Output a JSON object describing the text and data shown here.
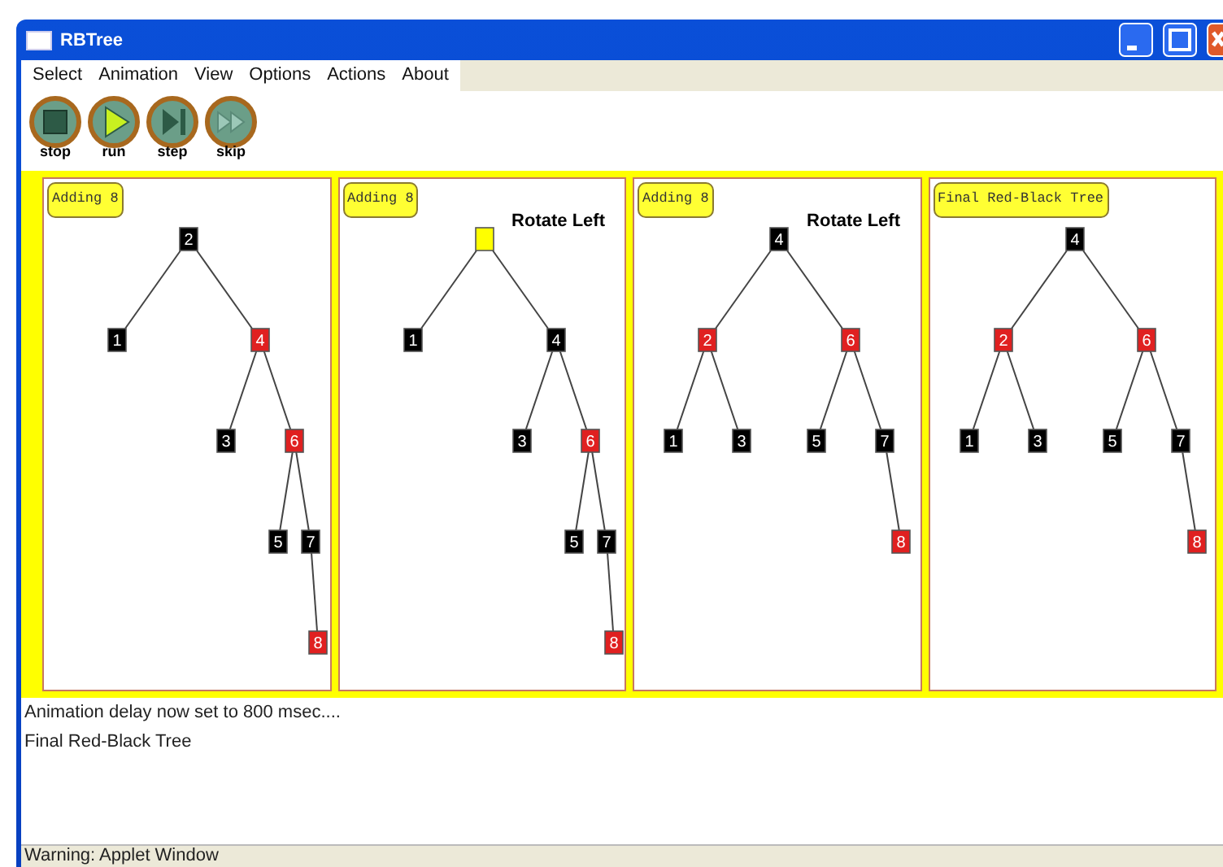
{
  "window": {
    "title": "RBTree"
  },
  "menu": [
    "Select",
    "Animation",
    "View",
    "Options",
    "Actions",
    "About"
  ],
  "toolbar": [
    {
      "kind": "stop",
      "label": "stop"
    },
    {
      "kind": "run",
      "label": "run"
    },
    {
      "kind": "step",
      "label": "step"
    },
    {
      "kind": "skip",
      "label": "skip"
    }
  ],
  "panels": [
    {
      "caption": "Adding 8",
      "root": {
        "key": "2",
        "color": "#000000",
        "children": [
          {
            "key": "1",
            "color": "#000000"
          },
          {
            "key": "4",
            "color": "#e02020",
            "children": [
              {
                "key": "3",
                "color": "#000000"
              },
              {
                "key": "6",
                "color": "#e02020",
                "children": [
                  {
                    "key": "5",
                    "color": "#000000"
                  },
                  {
                    "key": "7",
                    "color": "#000000",
                    "children": [
                      {
                        "key": "8",
                        "color": "#e02020",
                        "right_child": true
                      }
                    ]
                  }
                ]
              }
            ]
          }
        ]
      }
    },
    {
      "caption": "Adding 8",
      "operation": "Rotate Left",
      "root": {
        "color": "#ffff00",
        "children": [
          {
            "key": "1",
            "color": "#000000"
          },
          {
            "key": "4",
            "color": "#000000",
            "children": [
              {
                "key": "3",
                "color": "#000000"
              },
              {
                "key": "6",
                "color": "#e02020",
                "children": [
                  {
                    "key": "5",
                    "color": "#000000"
                  },
                  {
                    "key": "7",
                    "color": "#000000",
                    "children": [
                      {
                        "key": "8",
                        "color": "#e02020",
                        "right_child": true
                      }
                    ]
                  }
                ]
              }
            ]
          }
        ]
      }
    },
    {
      "caption": "Adding 8",
      "operation": "Rotate Left",
      "root": {
        "key": "4",
        "color": "#000000",
        "children": [
          {
            "key": "2",
            "color": "#e02020",
            "children": [
              {
                "key": "1",
                "color": "#000000"
              },
              {
                "key": "3",
                "color": "#000000"
              }
            ]
          },
          {
            "key": "6",
            "color": "#e02020",
            "children": [
              {
                "key": "5",
                "color": "#000000"
              },
              {
                "key": "7",
                "color": "#000000",
                "children": [
                  {
                    "key": "8",
                    "color": "#e02020",
                    "right_child": true
                  }
                ]
              }
            ]
          }
        ]
      }
    },
    {
      "caption": "Final Red-Black Tree",
      "root": {
        "key": "4",
        "color": "#000000",
        "children": [
          {
            "key": "2",
            "color": "#e02020",
            "children": [
              {
                "key": "1",
                "color": "#000000"
              },
              {
                "key": "3",
                "color": "#000000"
              }
            ]
          },
          {
            "key": "6",
            "color": "#e02020",
            "children": [
              {
                "key": "5",
                "color": "#000000"
              },
              {
                "key": "7",
                "color": "#000000",
                "children": [
                  {
                    "key": "8",
                    "color": "#e02020",
                    "right_child": true
                  }
                ]
              }
            ]
          }
        ]
      }
    }
  ],
  "log": [
    "Animation delay now set to 800 msec....",
    "Final Red-Black Tree"
  ],
  "status_bar": "Warning: Applet Window"
}
